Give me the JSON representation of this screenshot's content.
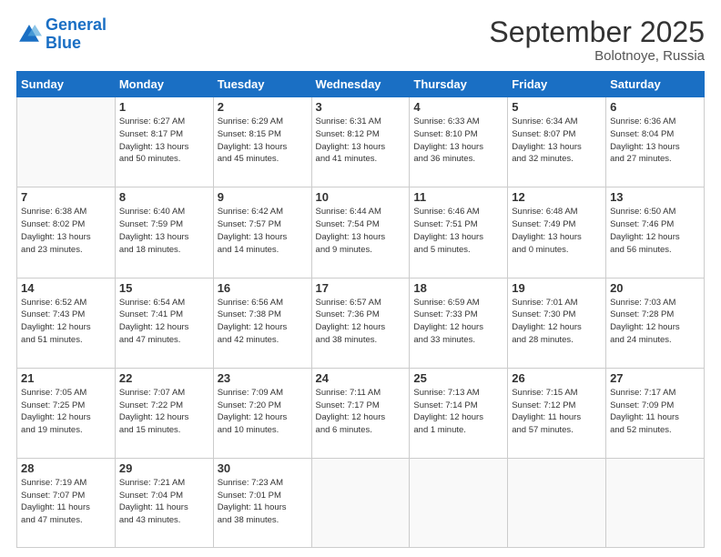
{
  "logo": {
    "line1": "General",
    "line2": "Blue"
  },
  "title": "September 2025",
  "subtitle": "Bolotnoye, Russia",
  "days_of_week": [
    "Sunday",
    "Monday",
    "Tuesday",
    "Wednesday",
    "Thursday",
    "Friday",
    "Saturday"
  ],
  "weeks": [
    [
      {
        "day": "",
        "info": ""
      },
      {
        "day": "1",
        "info": "Sunrise: 6:27 AM\nSunset: 8:17 PM\nDaylight: 13 hours\nand 50 minutes."
      },
      {
        "day": "2",
        "info": "Sunrise: 6:29 AM\nSunset: 8:15 PM\nDaylight: 13 hours\nand 45 minutes."
      },
      {
        "day": "3",
        "info": "Sunrise: 6:31 AM\nSunset: 8:12 PM\nDaylight: 13 hours\nand 41 minutes."
      },
      {
        "day": "4",
        "info": "Sunrise: 6:33 AM\nSunset: 8:10 PM\nDaylight: 13 hours\nand 36 minutes."
      },
      {
        "day": "5",
        "info": "Sunrise: 6:34 AM\nSunset: 8:07 PM\nDaylight: 13 hours\nand 32 minutes."
      },
      {
        "day": "6",
        "info": "Sunrise: 6:36 AM\nSunset: 8:04 PM\nDaylight: 13 hours\nand 27 minutes."
      }
    ],
    [
      {
        "day": "7",
        "info": "Sunrise: 6:38 AM\nSunset: 8:02 PM\nDaylight: 13 hours\nand 23 minutes."
      },
      {
        "day": "8",
        "info": "Sunrise: 6:40 AM\nSunset: 7:59 PM\nDaylight: 13 hours\nand 18 minutes."
      },
      {
        "day": "9",
        "info": "Sunrise: 6:42 AM\nSunset: 7:57 PM\nDaylight: 13 hours\nand 14 minutes."
      },
      {
        "day": "10",
        "info": "Sunrise: 6:44 AM\nSunset: 7:54 PM\nDaylight: 13 hours\nand 9 minutes."
      },
      {
        "day": "11",
        "info": "Sunrise: 6:46 AM\nSunset: 7:51 PM\nDaylight: 13 hours\nand 5 minutes."
      },
      {
        "day": "12",
        "info": "Sunrise: 6:48 AM\nSunset: 7:49 PM\nDaylight: 13 hours\nand 0 minutes."
      },
      {
        "day": "13",
        "info": "Sunrise: 6:50 AM\nSunset: 7:46 PM\nDaylight: 12 hours\nand 56 minutes."
      }
    ],
    [
      {
        "day": "14",
        "info": "Sunrise: 6:52 AM\nSunset: 7:43 PM\nDaylight: 12 hours\nand 51 minutes."
      },
      {
        "day": "15",
        "info": "Sunrise: 6:54 AM\nSunset: 7:41 PM\nDaylight: 12 hours\nand 47 minutes."
      },
      {
        "day": "16",
        "info": "Sunrise: 6:56 AM\nSunset: 7:38 PM\nDaylight: 12 hours\nand 42 minutes."
      },
      {
        "day": "17",
        "info": "Sunrise: 6:57 AM\nSunset: 7:36 PM\nDaylight: 12 hours\nand 38 minutes."
      },
      {
        "day": "18",
        "info": "Sunrise: 6:59 AM\nSunset: 7:33 PM\nDaylight: 12 hours\nand 33 minutes."
      },
      {
        "day": "19",
        "info": "Sunrise: 7:01 AM\nSunset: 7:30 PM\nDaylight: 12 hours\nand 28 minutes."
      },
      {
        "day": "20",
        "info": "Sunrise: 7:03 AM\nSunset: 7:28 PM\nDaylight: 12 hours\nand 24 minutes."
      }
    ],
    [
      {
        "day": "21",
        "info": "Sunrise: 7:05 AM\nSunset: 7:25 PM\nDaylight: 12 hours\nand 19 minutes."
      },
      {
        "day": "22",
        "info": "Sunrise: 7:07 AM\nSunset: 7:22 PM\nDaylight: 12 hours\nand 15 minutes."
      },
      {
        "day": "23",
        "info": "Sunrise: 7:09 AM\nSunset: 7:20 PM\nDaylight: 12 hours\nand 10 minutes."
      },
      {
        "day": "24",
        "info": "Sunrise: 7:11 AM\nSunset: 7:17 PM\nDaylight: 12 hours\nand 6 minutes."
      },
      {
        "day": "25",
        "info": "Sunrise: 7:13 AM\nSunset: 7:14 PM\nDaylight: 12 hours\nand 1 minute."
      },
      {
        "day": "26",
        "info": "Sunrise: 7:15 AM\nSunset: 7:12 PM\nDaylight: 11 hours\nand 57 minutes."
      },
      {
        "day": "27",
        "info": "Sunrise: 7:17 AM\nSunset: 7:09 PM\nDaylight: 11 hours\nand 52 minutes."
      }
    ],
    [
      {
        "day": "28",
        "info": "Sunrise: 7:19 AM\nSunset: 7:07 PM\nDaylight: 11 hours\nand 47 minutes."
      },
      {
        "day": "29",
        "info": "Sunrise: 7:21 AM\nSunset: 7:04 PM\nDaylight: 11 hours\nand 43 minutes."
      },
      {
        "day": "30",
        "info": "Sunrise: 7:23 AM\nSunset: 7:01 PM\nDaylight: 11 hours\nand 38 minutes."
      },
      {
        "day": "",
        "info": ""
      },
      {
        "day": "",
        "info": ""
      },
      {
        "day": "",
        "info": ""
      },
      {
        "day": "",
        "info": ""
      }
    ]
  ]
}
